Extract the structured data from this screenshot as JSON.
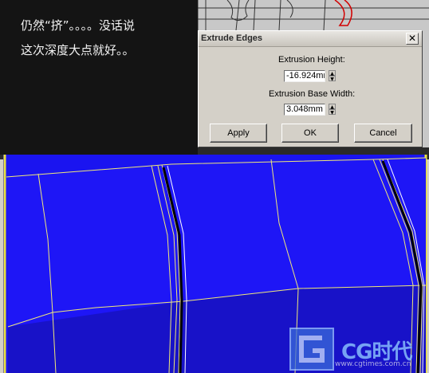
{
  "caption": {
    "line1": "仍然“挤”。。。。没话说",
    "line2": "这次深度大点就好。。"
  },
  "dialog": {
    "title": "Extrude Edges",
    "close_glyph": "✕",
    "height_label": "Extrusion Height:",
    "height_value": "-16.924mr",
    "width_label": "Extrusion Base Width:",
    "width_value": "3.048mm",
    "spin_up": "▲",
    "spin_down": "▼",
    "apply_label": "Apply",
    "ok_label": "OK",
    "cancel_label": "Cancel"
  },
  "watermark": {
    "text": "CG时代",
    "url": "www.cgtimes.com.cn"
  },
  "colors": {
    "face_blue": "#1a14f0",
    "face_dark_blue": "#1812c0",
    "edge_yellow": "#f0e878",
    "selected_edge": "#000000"
  }
}
